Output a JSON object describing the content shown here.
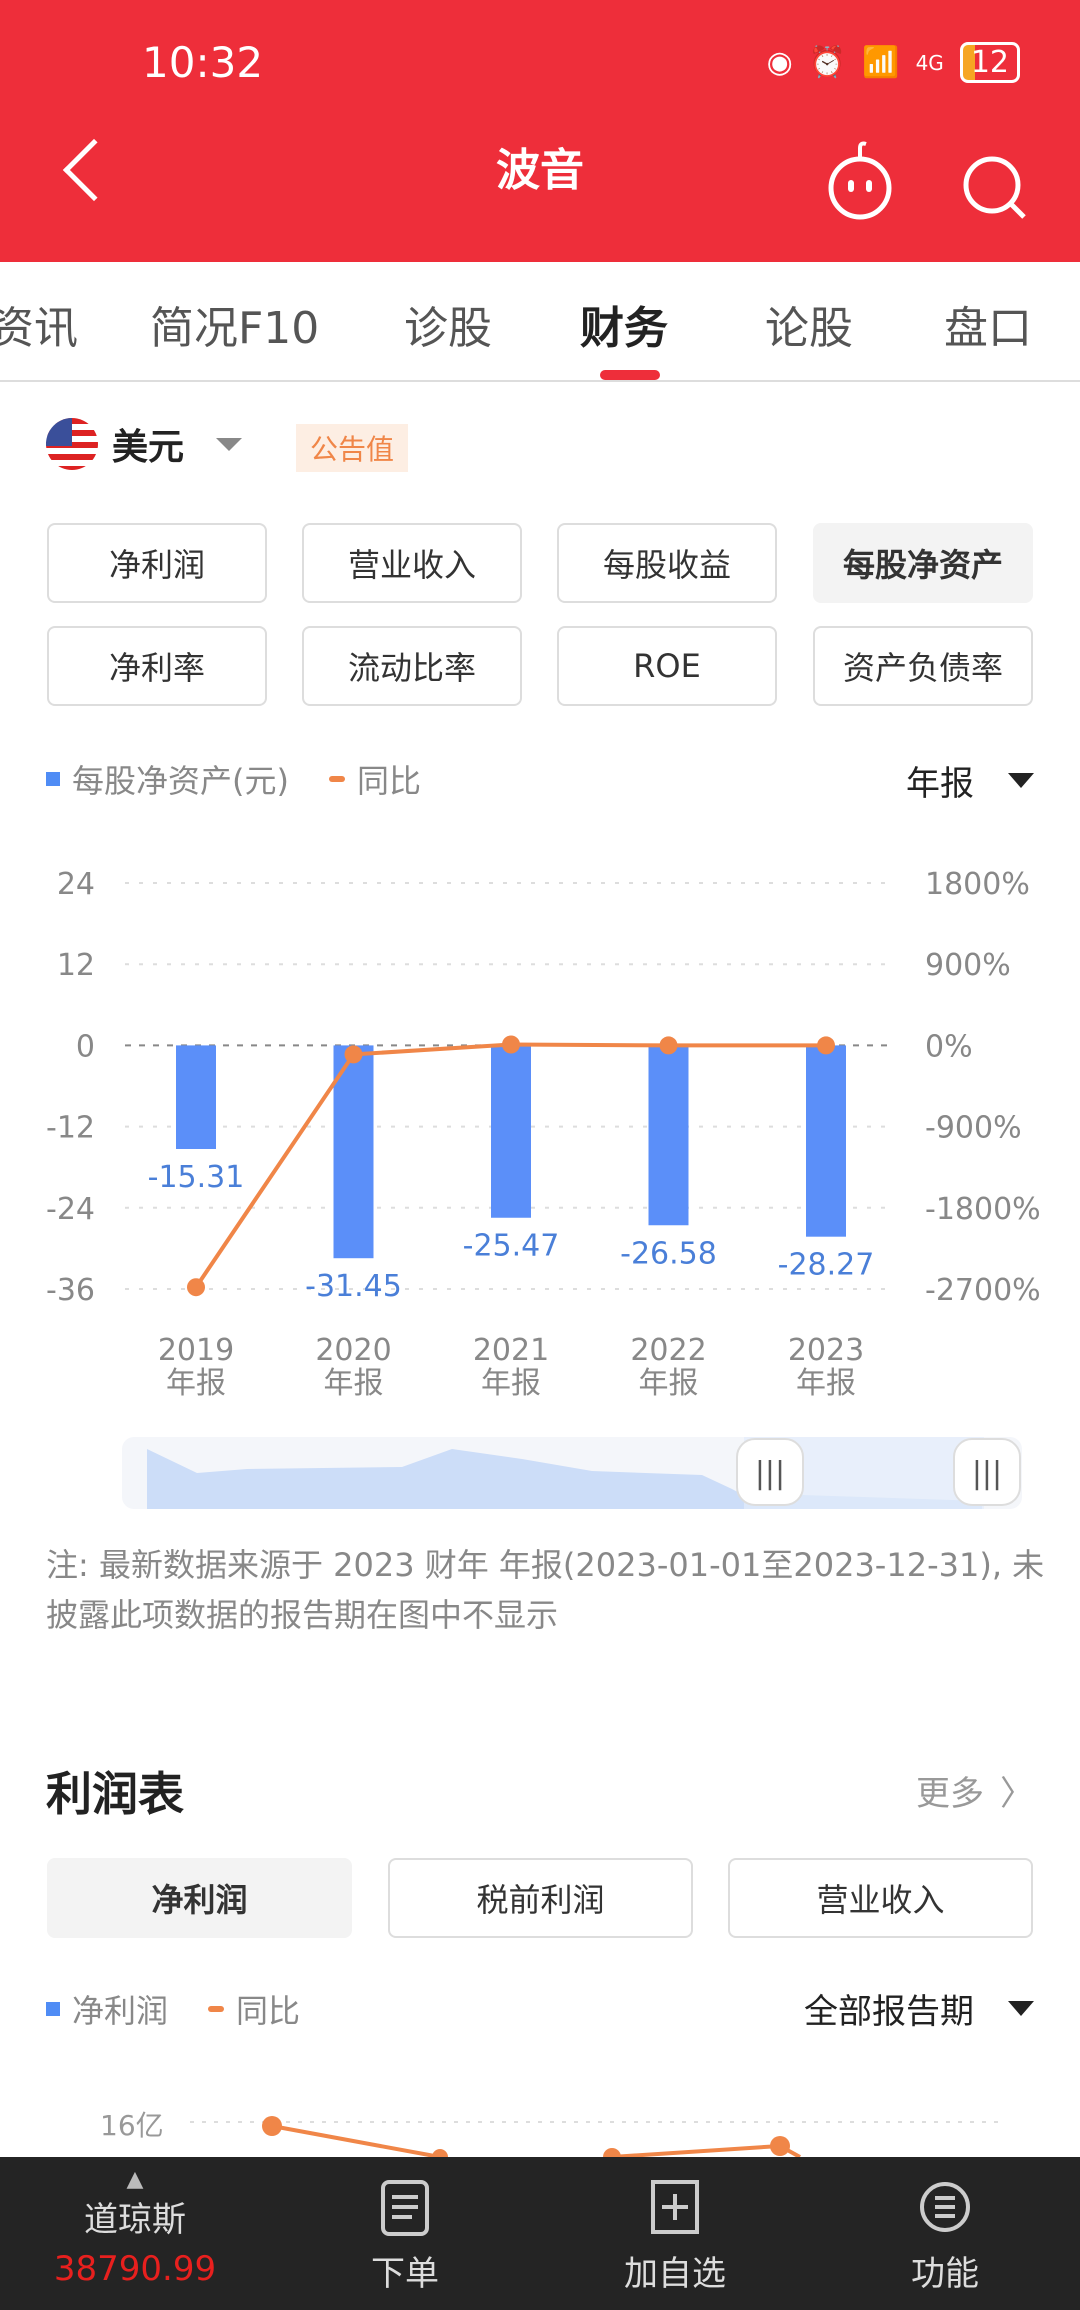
{
  "status": {
    "time": "10:32",
    "network": "4G",
    "battery": "12"
  },
  "header": {
    "title": "波音"
  },
  "tabs": [
    "资讯",
    "简况F10",
    "诊股",
    "财务",
    "论股",
    "盘口"
  ],
  "currency": {
    "label": "美元",
    "badge": "公告值"
  },
  "metrics": [
    "净利润",
    "营业收入",
    "每股收益",
    "每股净资产",
    "净利率",
    "流动比率",
    "ROE",
    "资产负债率"
  ],
  "selected_metric": "每股净资产",
  "legend": {
    "bar": "每股净资产(元)",
    "line": "同比"
  },
  "period_select": "年报",
  "chart_data": {
    "type": "bar+line",
    "categories": [
      "2019\n年报",
      "2020\n年报",
      "2021\n年报",
      "2022\n年报",
      "2023\n年报"
    ],
    "years": [
      "2019",
      "2020",
      "2021",
      "2022",
      "2023"
    ],
    "period_label": "年报",
    "series": [
      {
        "name": "每股净资产(元)",
        "type": "bar",
        "axis": "left",
        "values": [
          -15.31,
          -31.45,
          -25.47,
          -26.58,
          -28.27
        ],
        "color": "#5B8FF9"
      },
      {
        "name": "同比",
        "type": "line",
        "axis": "right",
        "values": [
          -2680,
          -100,
          10,
          0,
          0
        ],
        "color": "#F08648"
      }
    ],
    "left_ticks": [
      "24",
      "12",
      "0",
      "-12",
      "-24",
      "-36"
    ],
    "left_range": [
      -36,
      24
    ],
    "right_ticks": [
      "1800%",
      "900%",
      "0%",
      "-900%",
      "-1800%",
      "-2700%"
    ],
    "right_range": [
      -2700,
      1800
    ],
    "value_labels": [
      "-15.31",
      "-31.45",
      "-25.47",
      "-26.58",
      "-28.27"
    ]
  },
  "note": "注: 最新数据来源于 2023 财年 年报(2023-01-01至2023-12-31), 未披露此项数据的报告期在图中不显示",
  "profit": {
    "title": "利润表",
    "more": "更多",
    "tabs": [
      "净利润",
      "税前利润",
      "营业收入"
    ],
    "legend_bar": "净利润",
    "legend_line": "同比",
    "period": "全部报告期",
    "tick": "16亿"
  },
  "bottom": {
    "index_name": "道琼斯",
    "index_value": "38790.99",
    "items": [
      "下单",
      "加自选",
      "功能"
    ]
  }
}
